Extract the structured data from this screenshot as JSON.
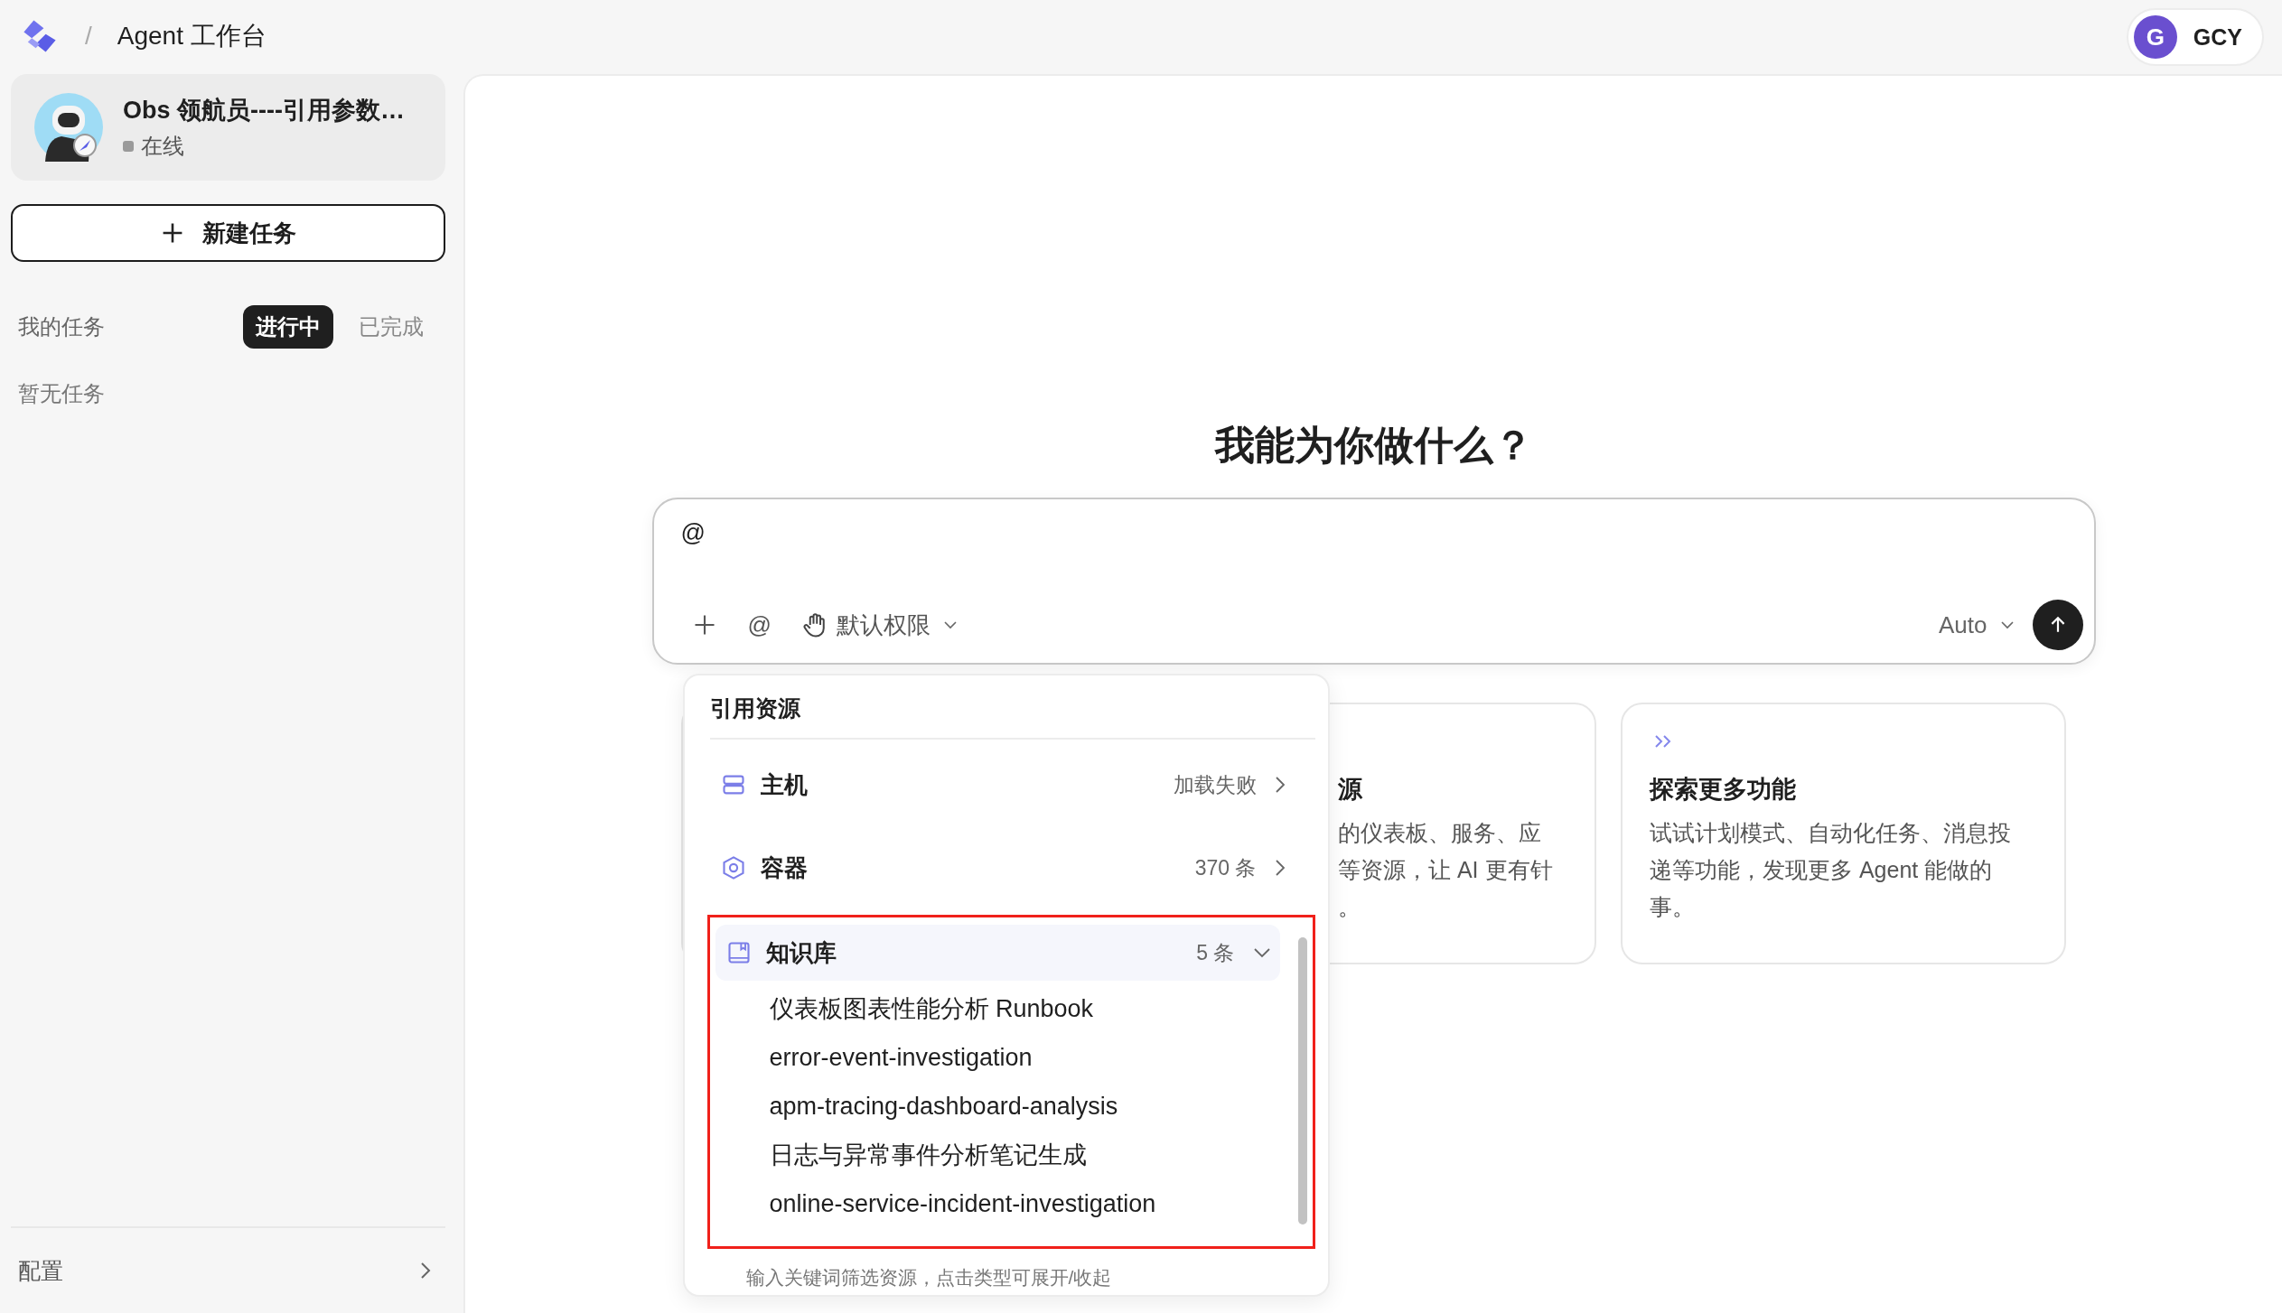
{
  "header": {
    "separator": "/",
    "title": "Agent 工作台",
    "user": {
      "initial": "G",
      "name": "GCY"
    }
  },
  "agent": {
    "name": "Obs 领航员----引用参数…",
    "status": "在线"
  },
  "new_task_button": "新建任务",
  "tasks": {
    "label": "我的任务",
    "tabs": [
      {
        "label": "进行中",
        "selected": true
      },
      {
        "label": "已完成",
        "selected": false
      }
    ],
    "empty": "暂无任务"
  },
  "settings": "配置",
  "main": {
    "heading": "我能为你做什么？",
    "input": {
      "value": "@",
      "mention": "@",
      "permission": "默认权限",
      "model": "Auto"
    }
  },
  "cards": [
    {
      "kind": "resources",
      "title": "源",
      "lines": [
        "的仪表板、服务、应",
        "等资源，让 AI 更有针",
        "。"
      ]
    },
    {
      "kind": "explore",
      "title": "探索更多功能",
      "lines": [
        "试试计划模式、自动化任务、消息投",
        "递等功能，发现更多 Agent 能做的",
        "事。"
      ]
    }
  ],
  "resource_menu": {
    "title": "引用资源",
    "categories": [
      {
        "kind": "host",
        "label": "主机",
        "count": "加载失败",
        "expanded": false,
        "highlighted": false
      },
      {
        "kind": "container",
        "label": "容器",
        "count": "370 条",
        "expanded": false,
        "highlighted": false
      },
      {
        "kind": "knowledge",
        "label": "知识库",
        "count": "5 条",
        "expanded": true,
        "highlighted": true,
        "items": [
          "仪表板图表性能分析 Runbook",
          "error-event-investigation",
          "apm-tracing-dashboard-analysis",
          "日志与异常事件分析笔记生成",
          "online-service-incident-investigation"
        ]
      }
    ],
    "hint": "输入关键词筛选资源，点击类型可展开/收起"
  }
}
